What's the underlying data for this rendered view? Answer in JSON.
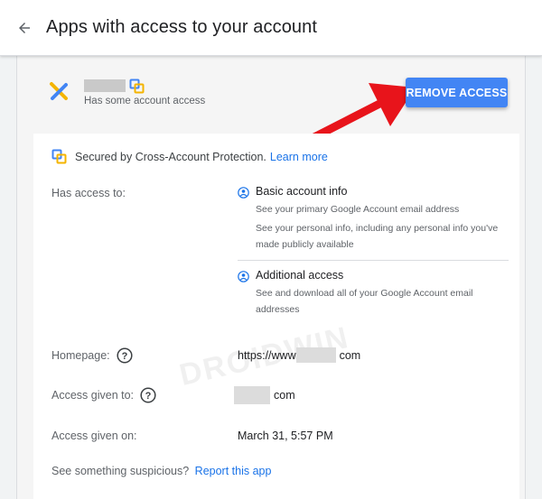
{
  "header": {
    "title": "Apps with access to your account",
    "back_icon": "arrow-back-icon"
  },
  "app": {
    "subtitle": "Has some account access",
    "remove_button": "REMOVE ACCESS"
  },
  "details": {
    "secured_text": "Secured by Cross-Account Protection.",
    "learn_more": "Learn more",
    "has_access_label": "Has access to:",
    "access_items": [
      {
        "title": "Basic account info",
        "desc1": "See your primary Google Account email address",
        "desc2": "See your personal info, including any personal info you've made publicly available"
      },
      {
        "title": "Additional access",
        "desc1": "See and download all of your Google Account email addresses"
      }
    ],
    "homepage_label": "Homepage:",
    "homepage_prefix": "https://www",
    "homepage_suffix": "com",
    "access_given_to_label": "Access given to:",
    "access_given_to_suffix": "com",
    "access_given_on_label": "Access given on:",
    "access_given_on_value": "March 31, 5:57 PM",
    "suspicious_text": "See something suspicious?",
    "report_link": "Report this app"
  },
  "watermark": "DROIDWIN",
  "colors": {
    "accent": "#4285f4",
    "link": "#1a73e8",
    "arrow": "#e8141b"
  }
}
